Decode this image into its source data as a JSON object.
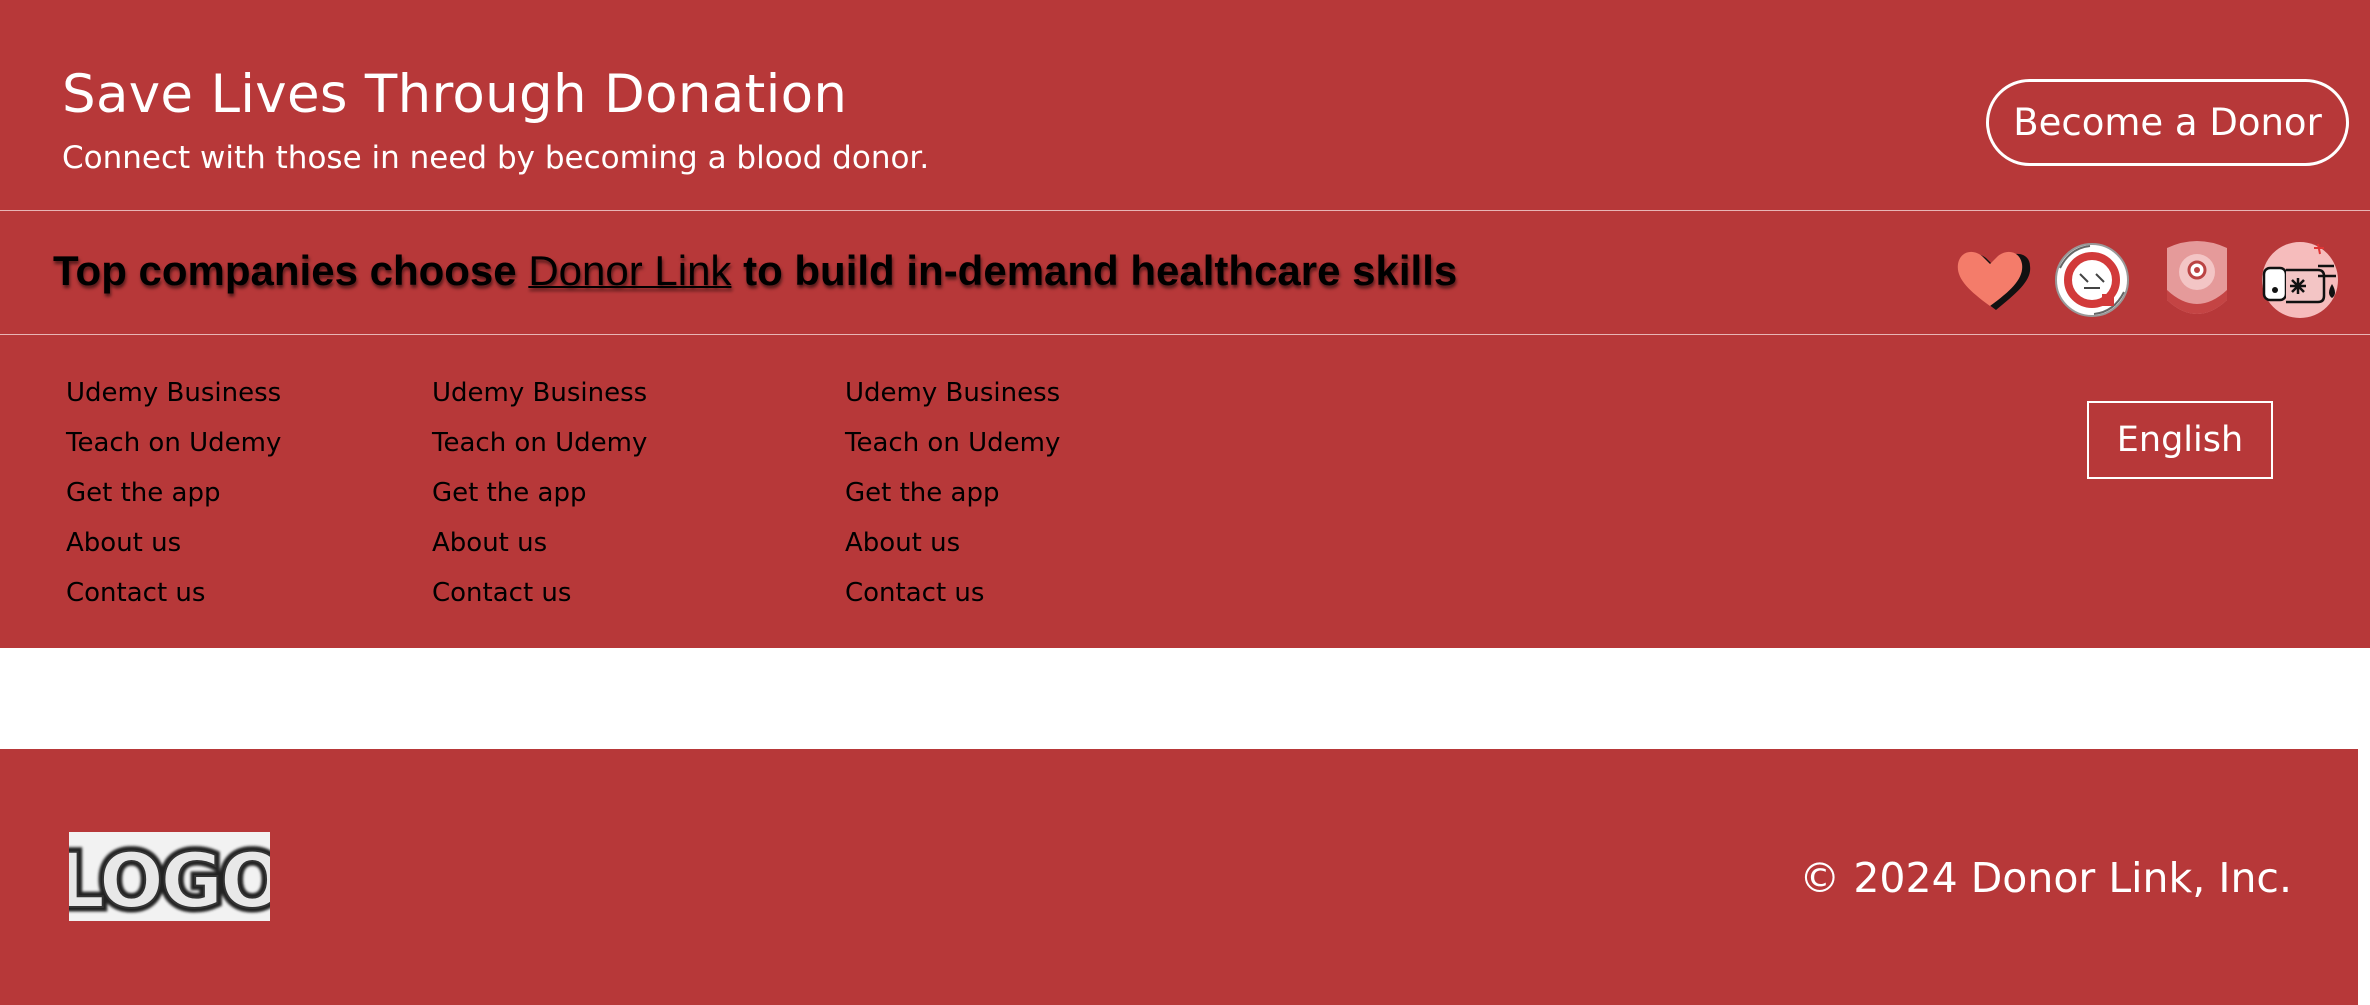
{
  "hero": {
    "title": "Save Lives Through Donation",
    "subtitle": "Connect with those in need by becoming a blood donor.",
    "cta_label": "Become a Donor"
  },
  "companies": {
    "text_before": "Top companies choose ",
    "brand": "Donor Link",
    "text_after": " to build in-demand healthcare skills",
    "icons": [
      "heart-icon",
      "helping-hands-icon",
      "doctor-icon",
      "blood-donation-hand-icon"
    ]
  },
  "links": {
    "columns": [
      [
        "Udemy Business",
        "Teach on Udemy",
        "Get the app",
        "About us",
        "Contact us"
      ],
      [
        "Udemy Business",
        "Teach on Udemy",
        "Get the app",
        "About us",
        "Contact us"
      ],
      [
        "Udemy Business",
        "Teach on Udemy",
        "Get the app",
        "About us",
        "Contact us"
      ]
    ],
    "language_label": "English"
  },
  "footer": {
    "logo_text": "LOGO",
    "copyright": "© 2024 Donor Link, Inc."
  },
  "colors": {
    "brand_red": "#b73839",
    "text_white": "#ffffff"
  }
}
